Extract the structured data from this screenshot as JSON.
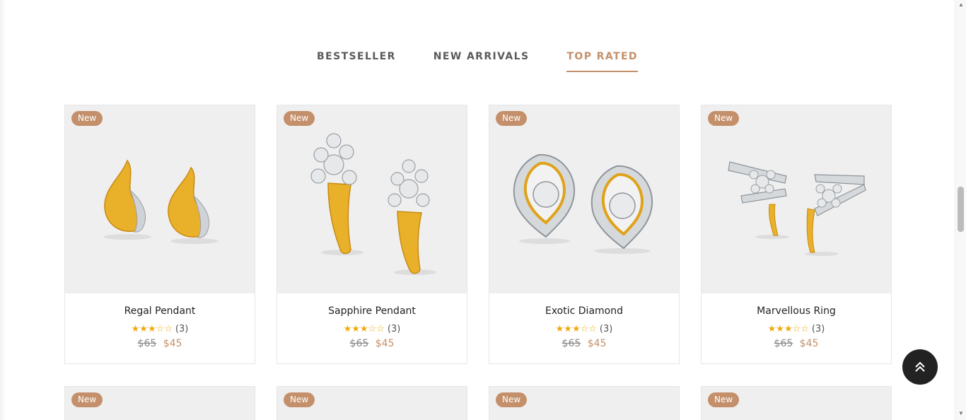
{
  "tabs": [
    {
      "label": "BESTSELLER",
      "active": false
    },
    {
      "label": "NEW ARRIVALS",
      "active": false
    },
    {
      "label": "TOP RATED",
      "active": true
    }
  ],
  "products": [
    {
      "badge": "New",
      "title": "Regal Pendant",
      "stars": "★★★☆☆",
      "rating": 3,
      "reviews": "(3)",
      "old_price": "$65",
      "new_price": "$45",
      "image": "gold-swirl-earrings"
    },
    {
      "badge": "New",
      "title": "Sapphire Pendant",
      "stars": "★★★☆☆",
      "rating": 3,
      "reviews": "(3)",
      "old_price": "$65",
      "new_price": "$45",
      "image": "flower-diamond-earrings"
    },
    {
      "badge": "New",
      "title": "Exotic Diamond",
      "stars": "★★★☆☆",
      "rating": 3,
      "reviews": "(3)",
      "old_price": "$65",
      "new_price": "$45",
      "image": "teardrop-solitaire-earrings"
    },
    {
      "badge": "New",
      "title": "Marvellous Ring",
      "stars": "★★★☆☆",
      "rating": 3,
      "reviews": "(3)",
      "old_price": "$65",
      "new_price": "$45",
      "image": "flower-bar-earrings"
    }
  ],
  "second_row_badges": [
    "New",
    "New",
    "New",
    "New"
  ],
  "colors": {
    "accent": "#c4906b",
    "star": "#f1a90e",
    "text": "#222222"
  },
  "scroll_top_icon": "double-chevron-up-icon"
}
